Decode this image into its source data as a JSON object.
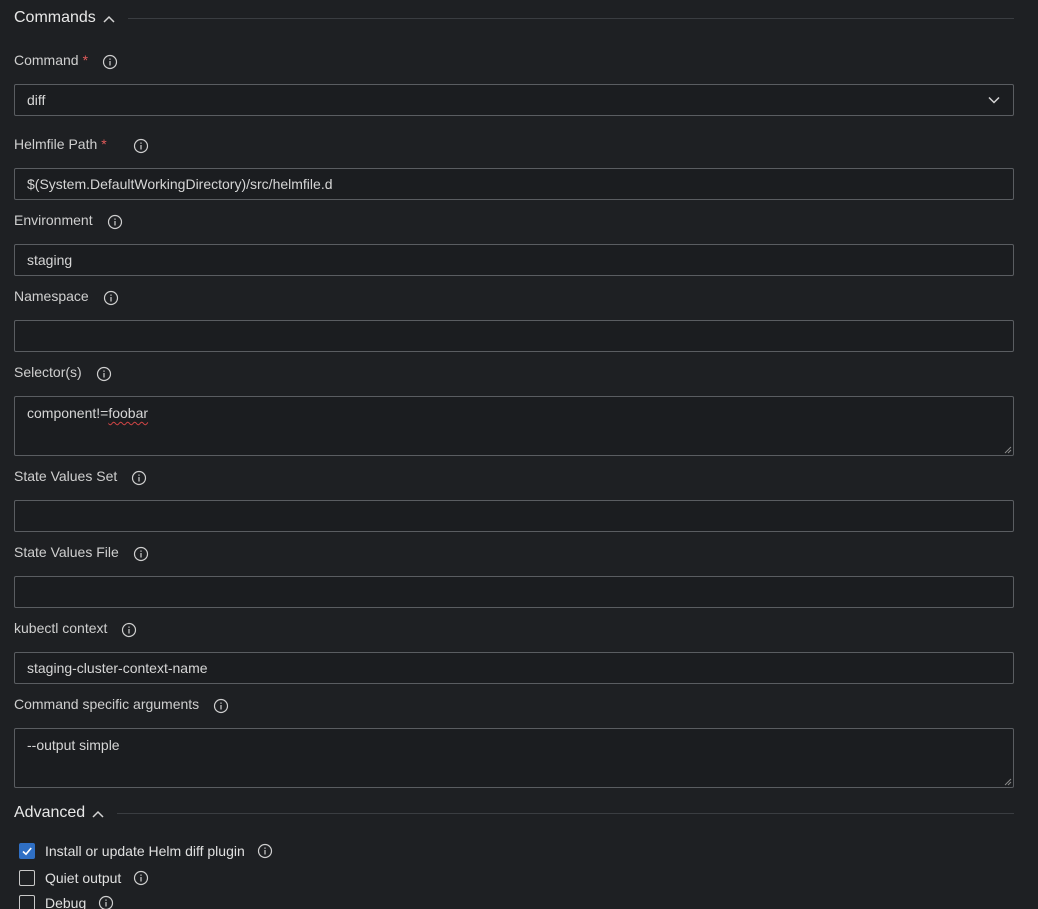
{
  "sections": {
    "commands_title": "Commands",
    "advanced_title": "Advanced"
  },
  "fields": {
    "command": {
      "label": "Command",
      "required_mark": "*",
      "value": "diff"
    },
    "helmfile_path": {
      "label": "Helmfile Path",
      "required_mark": "*",
      "value": "$(System.DefaultWorkingDirectory)/src/helmfile.d"
    },
    "environment": {
      "label": "Environment",
      "value": "staging"
    },
    "namespace": {
      "label": "Namespace",
      "value": ""
    },
    "selectors": {
      "label": "Selector(s)",
      "value_prefix": "component!=",
      "value_misspelled": "foobar"
    },
    "state_values_set": {
      "label": "State Values Set",
      "value": ""
    },
    "state_values_file": {
      "label": "State Values File",
      "value": ""
    },
    "kubectl_context": {
      "label": "kubectl context",
      "value": "staging-cluster-context-name"
    },
    "command_args": {
      "label": "Command specific arguments",
      "value": "--output simple"
    }
  },
  "advanced": {
    "install_helm_diff": {
      "label": "Install or update Helm diff plugin",
      "checked": true
    },
    "quiet_output": {
      "label": "Quiet output",
      "checked": false
    },
    "debug": {
      "label": "Debug",
      "checked": false
    }
  },
  "colors": {
    "background": "#1e2023",
    "field_border": "#5a5d61",
    "required": "#e05a5a",
    "checkbox_checked": "#2f6fc4"
  },
  "icons": {
    "info": "info-circle-icon",
    "section_toggle": "chevron-up-icon",
    "dropdown": "chevron-down-icon"
  }
}
